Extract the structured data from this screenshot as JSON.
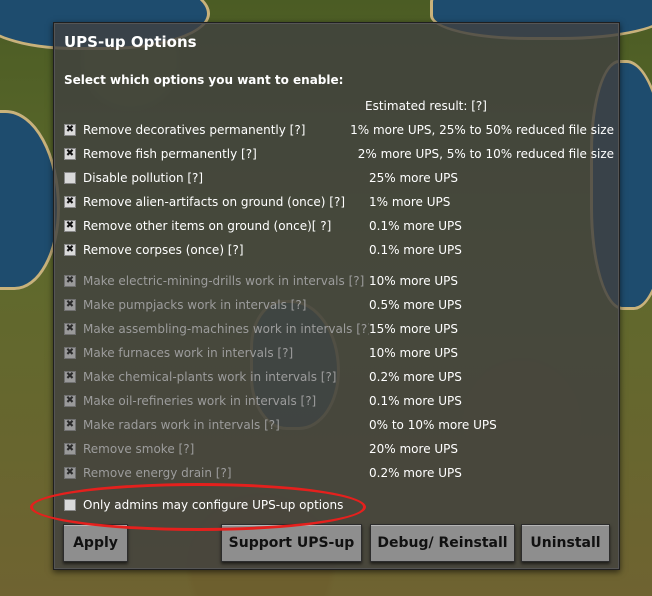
{
  "dialog": {
    "title": "UPS-up Options",
    "subtitle": "Select which options you want to enable:",
    "estimated_header": "Estimated result: [?]"
  },
  "options": [
    {
      "label": "Remove decoratives permanently [?]",
      "result": "1% more UPS, 25% to 50% reduced file size",
      "checked": true,
      "dim": false
    },
    {
      "label": "Remove fish permanently [?]",
      "result": "2% more UPS, 5% to 10% reduced file size",
      "checked": true,
      "dim": false
    },
    {
      "label": "Disable pollution [?]",
      "result": "25% more UPS",
      "checked": false,
      "dim": false
    },
    {
      "label": "Remove alien-artifacts on ground (once) [?]",
      "result": "1% more UPS",
      "checked": true,
      "dim": false
    },
    {
      "label": "Remove other items on ground (once)[ ?]",
      "result": "0.1% more UPS",
      "checked": true,
      "dim": false
    },
    {
      "label": "Remove corpses (once) [?]",
      "result": "0.1% more UPS",
      "checked": true,
      "dim": false
    },
    {
      "label": "Make electric-mining-drills work in intervals [?]",
      "result": "10% more UPS",
      "checked": true,
      "dim": true
    },
    {
      "label": "Make pumpjacks work in intervals [?]",
      "result": "0.5% more UPS",
      "checked": true,
      "dim": true
    },
    {
      "label": "Make assembling-machines work in intervals [?]",
      "result": "15% more UPS",
      "checked": true,
      "dim": true
    },
    {
      "label": "Make furnaces work in intervals [?]",
      "result": "10% more UPS",
      "checked": true,
      "dim": true
    },
    {
      "label": "Make chemical-plants work in intervals [?]",
      "result": "0.2% more UPS",
      "checked": true,
      "dim": true
    },
    {
      "label": "Make oil-refineries work in intervals [?]",
      "result": "0.1% more UPS",
      "checked": true,
      "dim": true
    },
    {
      "label": "Make radars work in intervals [?]",
      "result": "0% to 10% more UPS",
      "checked": true,
      "dim": true
    },
    {
      "label": "Remove smoke [?]",
      "result": "20% more UPS",
      "checked": true,
      "dim": true
    },
    {
      "label": "Remove energy drain [?]",
      "result": "0.2% more UPS",
      "checked": true,
      "dim": true
    }
  ],
  "admin_option": {
    "label": "Only admins may configure UPS-up options",
    "checked": false
  },
  "buttons": {
    "apply": "Apply",
    "support": "Support UPS-up",
    "debug": "Debug/ Reinstall",
    "uninstall": "Uninstall"
  },
  "colors": {
    "highlight_circle": "#e5201d",
    "button_bg": "#8e8e8e",
    "panel_bg": "#404040"
  },
  "icons": {
    "checked": "cross-mark-icon",
    "unchecked": "empty-checkbox-icon"
  }
}
